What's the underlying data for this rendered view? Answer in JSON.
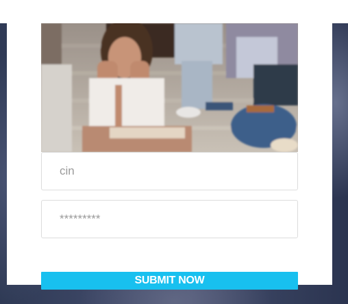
{
  "login_form": {
    "username_value": "cin",
    "password_value": "*********",
    "submit_label": "SUBMIT NOW"
  },
  "colors": {
    "accent": "#18c0ef",
    "card_background": "#ffffff",
    "field_border": "#dcdcdc",
    "page_background": "#3d4766"
  }
}
